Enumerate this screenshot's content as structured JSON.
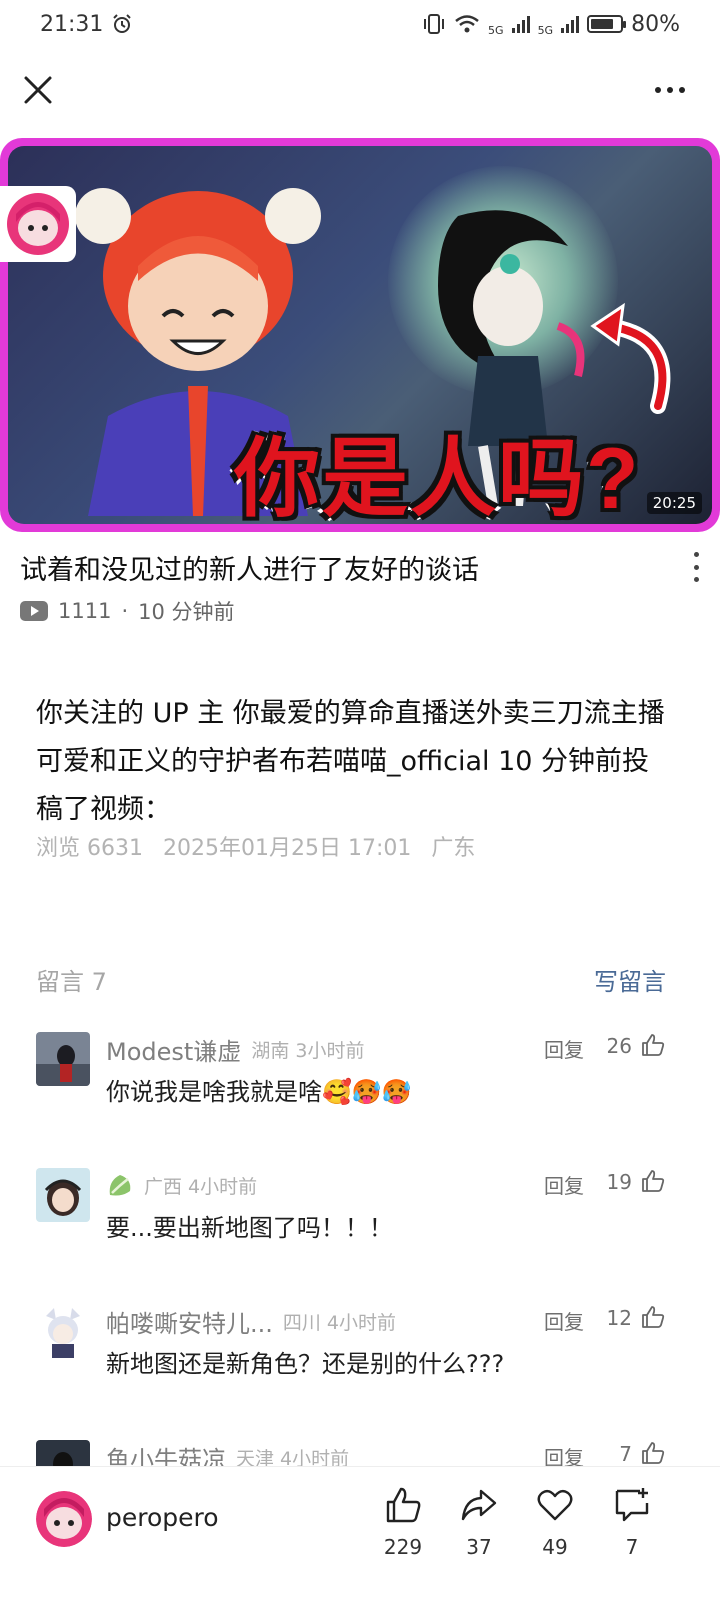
{
  "status_bar": {
    "time": "21:31",
    "network_1": "5G",
    "network_2": "5G",
    "battery": "80%",
    "battery_level": 0.8
  },
  "video": {
    "thumbnail_caption": "你是人吗?",
    "duration": "20:25",
    "title": "试着和没见过的新人进行了友好的谈话",
    "views": "1111",
    "separator": "·",
    "time_ago": "10 分钟前"
  },
  "article": {
    "body": "你关注的 UP 主 你最爱的算命直播送外卖三刀流主播可爱和正义的守护者布若喵喵_official 10 分钟前投稿了视频：",
    "views": "浏览 6631",
    "datetime": "2025年01月25日 17:01",
    "location": "广东"
  },
  "comments_section": {
    "count_label": "留言 7",
    "write_label": "写留言",
    "reply_label": "回复",
    "items": [
      {
        "name": "Modest谦虚",
        "location_time": "湖南 3小时前",
        "likes": "26",
        "text": "你说我是啥我就是啥🥰🥵🥵"
      },
      {
        "name": "",
        "name_icon": "cabbage-icon",
        "location_time": "广西 4小时前",
        "likes": "19",
        "text": "要...要出新地图了吗！！！"
      },
      {
        "name": "帕喽嘶安特儿...",
        "location_time": "四川 4小时前",
        "likes": "12",
        "text": "新地图还是新角色？还是别的什么???"
      },
      {
        "name": "鱼小牛菇凉",
        "location_time": "天津 4小时前",
        "likes": "7",
        "text": ""
      }
    ]
  },
  "bottom_bar": {
    "author": "peropero",
    "like_count": "229",
    "share_count": "37",
    "favorite_count": "49",
    "comment_count": "7"
  },
  "colors": {
    "accent_link": "#4a6a96",
    "card_border": "#e23ad8",
    "caption_red": "#e0141e"
  }
}
